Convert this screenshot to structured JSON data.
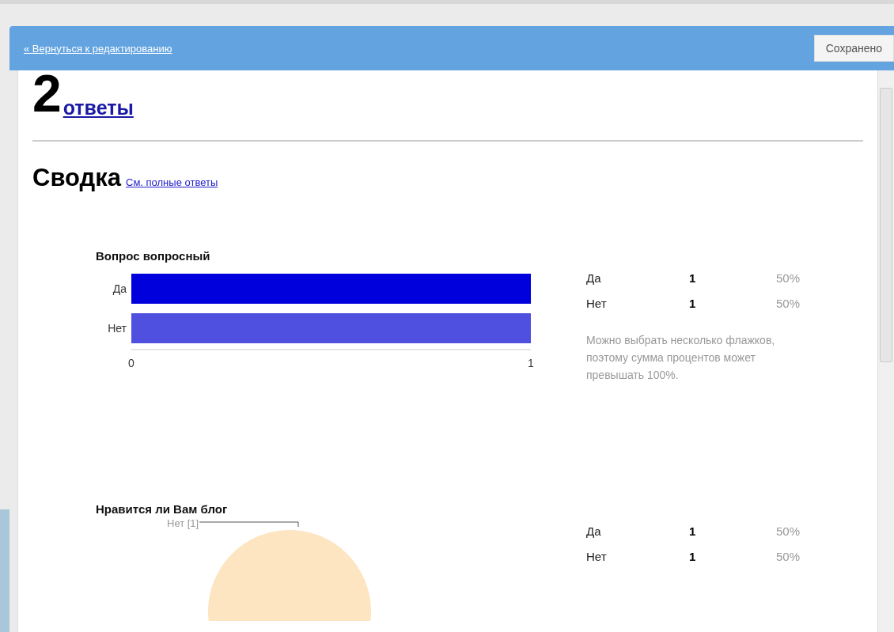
{
  "top_bar": {
    "back_link": "« Вернуться к редактированию",
    "save_button": "Сохранено"
  },
  "responses": {
    "count": "2",
    "link": "ответы"
  },
  "summary": {
    "title": "Сводка",
    "link": "См. полные ответы"
  },
  "questions": [
    {
      "kind": "bar",
      "title": "Вопрос вопросный",
      "chart_data": {
        "type": "bar",
        "orientation": "horizontal",
        "categories": [
          "Да",
          "Нет"
        ],
        "values": [
          1,
          1
        ],
        "colors": [
          "#0000dd",
          "#5050e0"
        ],
        "xticks": [
          0,
          1
        ],
        "xlim": [
          0,
          1
        ]
      },
      "stats": [
        {
          "label": "Да",
          "count": "1",
          "percent": "50%"
        },
        {
          "label": "Нет",
          "count": "1",
          "percent": "50%"
        }
      ],
      "note": "Можно выбрать несколько флажков, поэтому сумма процентов может превышать 100%."
    },
    {
      "kind": "pie",
      "title": "Нравится ли Вам блог",
      "slice_label": "Нет [1]",
      "stats": [
        {
          "label": "Да",
          "count": "1",
          "percent": "50%"
        },
        {
          "label": "Нет",
          "count": "1",
          "percent": "50%"
        }
      ]
    }
  ]
}
